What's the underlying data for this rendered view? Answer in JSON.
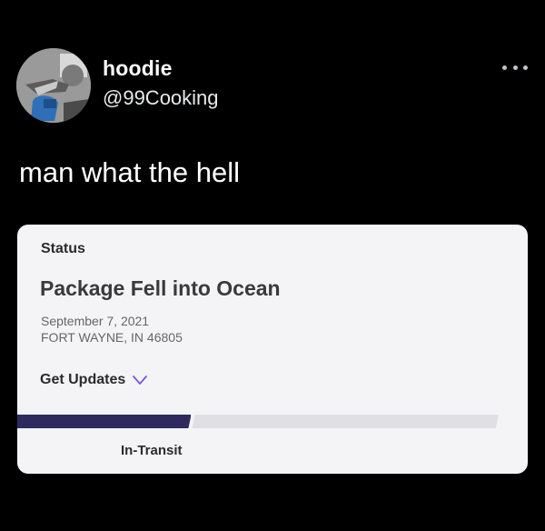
{
  "tweet": {
    "author": {
      "name": "hoodie",
      "handle": "@99Cooking",
      "avatar_icon": "avatar-photo"
    },
    "more_icon": "more-horizontal-icon",
    "text": "man what the hell"
  },
  "shipment_card": {
    "section_label": "Status",
    "headline": "Package Fell into Ocean",
    "date": "September 7, 2021",
    "location": "FORT WAYNE, IN 46805",
    "get_updates_label": "Get Updates",
    "get_updates_icon": "chevron-down-icon",
    "progress": {
      "fraction": 0.36,
      "label": "In-Transit",
      "fill_color": "#2f2a5e",
      "track_color": "#e0e0e4"
    }
  },
  "colors": {
    "background": "#000000",
    "card_background": "#f4f4f7",
    "text_primary": "#ffffff"
  }
}
